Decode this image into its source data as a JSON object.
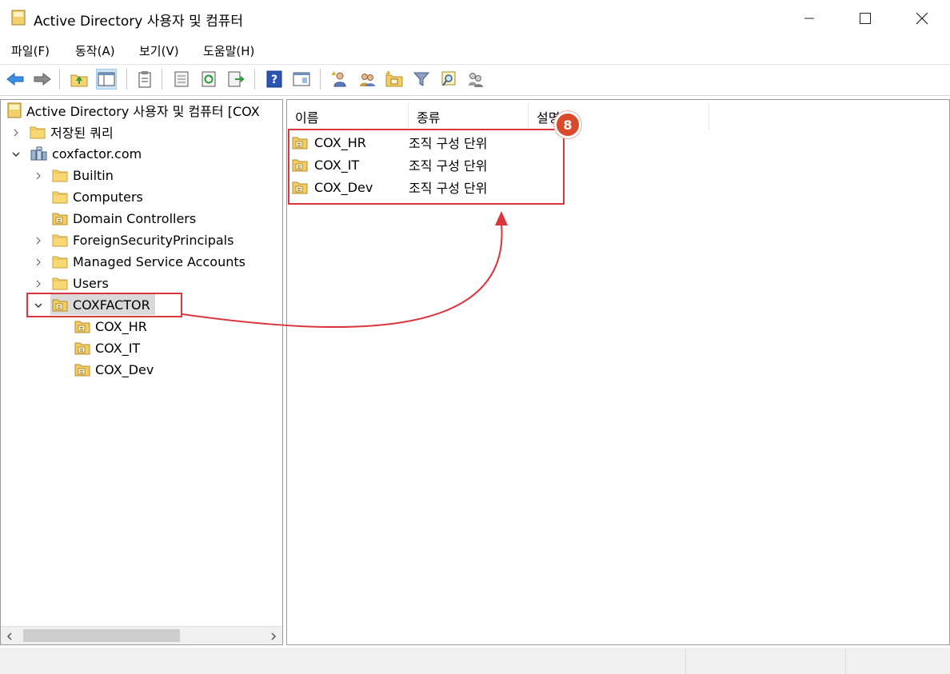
{
  "window": {
    "title": "Active Directory 사용자 및 컴퓨터",
    "minimize_glyph": "─",
    "maximize_glyph": "☐",
    "close_glyph": "✕"
  },
  "menu": [
    "파일(F)",
    "동작(A)",
    "보기(V)",
    "도움말(H)"
  ],
  "toolbar": {
    "icons": [
      "back-icon",
      "forward-icon",
      "up-folder-icon",
      "show-hide-tree-icon",
      "clipboard-icon",
      "properties-icon",
      "refresh-icon",
      "export-list-icon",
      "help-icon",
      "console-icon",
      "new-user-icon",
      "new-group-icon",
      "new-ou-icon",
      "filter-icon",
      "find-icon",
      "add-to-group-icon"
    ]
  },
  "tree": {
    "root": "Active Directory 사용자 및 컴퓨터 [COX",
    "saved_queries": "저장된 쿼리",
    "domain": "coxfactor.com",
    "children": [
      "Builtin",
      "Computers",
      "Domain Controllers",
      "ForeignSecurityPrincipals",
      "Managed Service Accounts",
      "Users",
      "COXFACTOR"
    ],
    "ou_children": [
      "COX_HR",
      "COX_IT",
      "COX_Dev"
    ],
    "selected": "COXFACTOR"
  },
  "list": {
    "columns": [
      "이름",
      "종류",
      "설명"
    ],
    "rows": [
      {
        "name": "COX_HR",
        "type": "조직 구성 단위"
      },
      {
        "name": "COX_IT",
        "type": "조직 구성 단위"
      },
      {
        "name": "COX_Dev",
        "type": "조직 구성 단위"
      }
    ]
  },
  "annotation": {
    "step": "8",
    "color": "#d9363e"
  }
}
